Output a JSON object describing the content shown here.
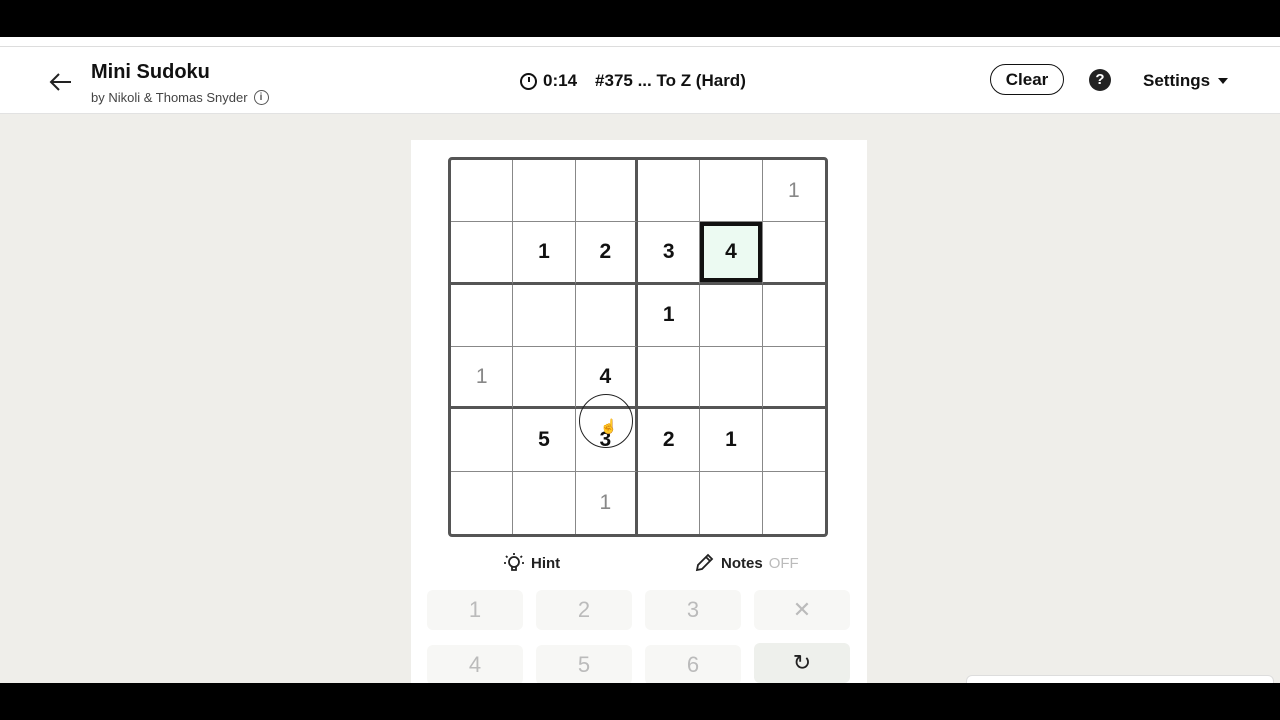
{
  "header": {
    "title": "Mini Sudoku",
    "byline": "by Nikoli & Thomas Snyder",
    "timer": "0:14",
    "puzzle_name": "#375 ... To Z (Hard)",
    "clear_label": "Clear",
    "help_symbol": "?",
    "settings_label": "Settings"
  },
  "board": {
    "rows": [
      [
        "",
        "",
        "",
        "",
        "",
        "1"
      ],
      [
        "",
        "1",
        "2",
        "3",
        "4",
        ""
      ],
      [
        "",
        "",
        "",
        "1",
        "",
        ""
      ],
      [
        "1",
        "",
        "4",
        "",
        "",
        ""
      ],
      [
        "",
        "5",
        "3",
        "2",
        "1",
        ""
      ],
      [
        "",
        "",
        "1",
        "",
        "",
        ""
      ]
    ],
    "entered_cells": [
      "0-5",
      "3-0",
      "5-2"
    ],
    "selected_cell": "1-4"
  },
  "controls": {
    "hint_label": "Hint",
    "notes_label": "Notes",
    "notes_state": "OFF"
  },
  "keypad": {
    "row1": [
      "1",
      "2",
      "3",
      "✕"
    ],
    "row2": [
      "4",
      "5",
      "6",
      "↻"
    ]
  },
  "colors": {
    "selected_bg": "#ecfaf2",
    "page_bg": "#efeeea"
  }
}
